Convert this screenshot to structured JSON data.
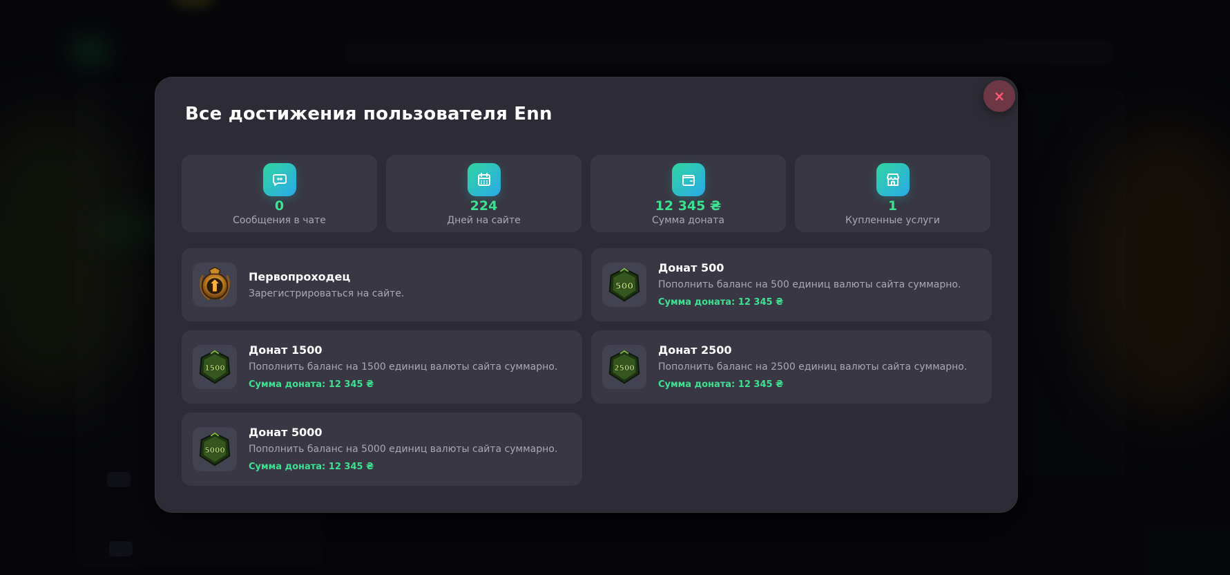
{
  "modal": {
    "title": "Все достижения пользователя Enn",
    "close_icon": "close-icon",
    "close_label": "×"
  },
  "stats": [
    {
      "icon": "chat-icon",
      "value": "0",
      "label": "Сообщения в чате"
    },
    {
      "icon": "calendar-icon",
      "value": "224",
      "label": "Дней на сайте"
    },
    {
      "icon": "wallet-icon",
      "value": "12 345 ₴",
      "label": "Сумма доната"
    },
    {
      "icon": "store-icon",
      "value": "1",
      "label": "Купленные услуги"
    }
  ],
  "achievements": [
    {
      "badge": "pioneer-medal-icon",
      "title": "Первопроходец",
      "description": "Зарегистрироваться на сайте.",
      "sum": ""
    },
    {
      "badge": "donate-500-badge-icon",
      "badge_text": "500",
      "title": "Донат 500",
      "description": "Пополнить баланс на 500 единиц валюты сайта суммарно.",
      "sum": "Сумма доната: 12 345 ₴"
    },
    {
      "badge": "donate-1500-badge-icon",
      "badge_text": "1500",
      "title": "Донат 1500",
      "description": "Пополнить баланс на 1500 единиц валюты сайта суммарно.",
      "sum": "Сумма доната: 12 345 ₴"
    },
    {
      "badge": "donate-2500-badge-icon",
      "badge_text": "2500",
      "title": "Донат 2500",
      "description": "Пополнить баланс на 2500 единиц валюты сайта суммарно.",
      "sum": "Сумма доната: 12 345 ₴"
    },
    {
      "badge": "donate-5000-badge-icon",
      "badge_text": "5000",
      "title": "Донат 5000",
      "description": "Пополнить баланс на 5000 единиц валюты сайта суммарно.",
      "sum": "Сумма доната: 12 345 ₴"
    }
  ],
  "colors": {
    "accent_green": "#3ee091",
    "icon_gradient_start": "#30d6a0",
    "icon_gradient_end": "#2aa8e8",
    "modal_bg": "#2d2c36",
    "card_bg": "#383743",
    "close_bg": "#6e3746"
  }
}
